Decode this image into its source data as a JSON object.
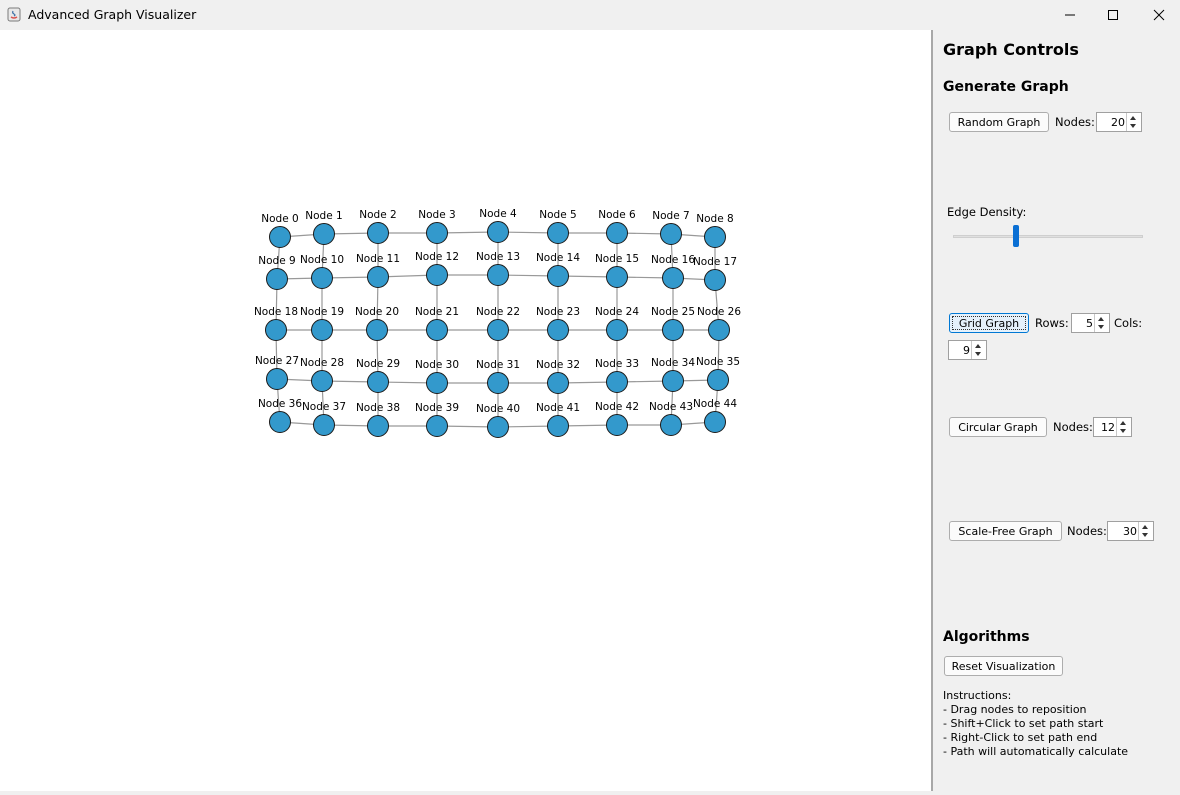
{
  "window": {
    "title": "Advanced Graph Visualizer"
  },
  "graph": {
    "node_label_prefix": "Node",
    "rows": [
      [
        "Node 0",
        "Node 1",
        "Node 2",
        "Node 3",
        "Node 4",
        "Node 5",
        "Node 6",
        "Node 7",
        "Node 8"
      ],
      [
        "Node 9",
        "Node 10",
        "Node 11",
        "Node 12",
        "Node 13",
        "Node 14",
        "Node 15",
        "Node 16",
        "Node 17"
      ],
      [
        "Node 18",
        "Node 19",
        "Node 20",
        "Node 21",
        "Node 22",
        "Node 23",
        "Node 24",
        "Node 25",
        "Node 26"
      ],
      [
        "Node 27",
        "Node 28",
        "Node 29",
        "Node 30",
        "Node 31",
        "Node 32",
        "Node 33",
        "Node 34",
        "Node 35"
      ],
      [
        "Node 36",
        "Node 37",
        "Node 38",
        "Node 39",
        "Node 40",
        "Node 41",
        "Node 42",
        "Node 43",
        "Node 44"
      ]
    ],
    "node_color": "#3399cc",
    "edge_color": "#999999"
  },
  "panel": {
    "title": "Graph Controls",
    "generate_heading": "Generate Graph",
    "random": {
      "button": "Random Graph",
      "nodes_label": "Nodes:",
      "nodes_value": "20"
    },
    "edge_density_label": "Edge Density:",
    "edge_density_value": 0.33,
    "grid": {
      "button": "Grid Graph",
      "rows_label": "Rows:",
      "rows_value": "5",
      "cols_label": "Cols:",
      "cols_value": "9"
    },
    "circular": {
      "button": "Circular Graph",
      "nodes_label": "Nodes:",
      "nodes_value": "12"
    },
    "scalefree": {
      "button": "Scale-Free Graph",
      "nodes_label": "Nodes:",
      "nodes_value": "30"
    },
    "algorithms_heading": "Algorithms",
    "reset_button": "Reset Visualization",
    "instructions": [
      "Instructions:",
      "- Drag nodes to reposition",
      "- Shift+Click to set path start",
      "- Right-Click to set path end",
      "- Path will automatically calculate"
    ]
  }
}
